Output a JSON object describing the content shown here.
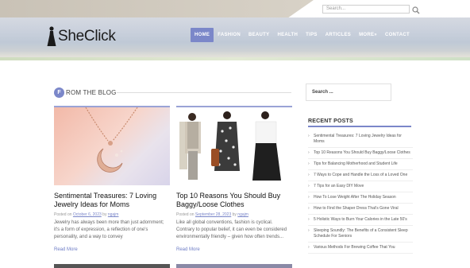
{
  "header": {
    "search_placeholder": "Search...",
    "logo_text": "SheClick",
    "nav": [
      {
        "label": "HOME",
        "active": true
      },
      {
        "label": "FASHION",
        "active": false
      },
      {
        "label": "BEAUTY",
        "active": false
      },
      {
        "label": "HEALTH",
        "active": false
      },
      {
        "label": "TIPS",
        "active": false
      },
      {
        "label": "ARTICLES",
        "active": false
      },
      {
        "label": "MORE»",
        "active": false
      },
      {
        "label": "CONTACT",
        "active": false
      }
    ]
  },
  "main": {
    "section_badge": "F",
    "section_title": "ROM THE BLOG",
    "posts": [
      {
        "title": "Sentimental Treasures: 7 Loving Jewelry Ideas for Moms",
        "meta_prefix": "Posted on",
        "date": "October 6, 2023",
        "meta_by": "by",
        "author": "ngajm",
        "excerpt": "Jewelry has always been more than just adornment; it's a form of expression, a reflection of one's personality, and a way to convey",
        "read_more": "Read More",
        "image": "necklace-photo"
      },
      {
        "title": "Top 10 Reasons You Should Buy Baggy/Loose Clothes",
        "meta_prefix": "Posted on",
        "date": "September 28, 2023",
        "meta_by": "by",
        "author": "ngajm",
        "excerpt": "Like all global conventions, fashion is cyclical. Contrary to popular belief, it can even be considered environmentally friendly – given how often trends...",
        "read_more": "Read More",
        "image": "clothes-photo"
      }
    ]
  },
  "sidebar": {
    "search_label": "Search ...",
    "recent_title": "RECENT POSTS",
    "recent_posts": [
      "Sentimental Treasures: 7 Loving Jewelry Ideas for Moms",
      "Top 10 Reasons You Should Buy Baggy/Loose Clothes",
      "Tips for Balancing Motherhood and Student Life",
      "7 Ways to Cope and Handle the Loss of a Loved One",
      "7 Tips for an Easy DIY Move",
      "How To Lose Weight After The Holiday Season",
      "How to Find the Shaper Dress That's Gone Viral",
      "5 Holistic Ways to Burn Your Calories in the Late 50's",
      "Sleeping Soundly: The Benefits of a Consistent Sleep Schedule For Seniors",
      "Various Methods For Brewing Coffee That You"
    ]
  },
  "colors": {
    "accent": "#7b87c9",
    "nav_text": "#ffffff",
    "link": "#6e7dc6"
  }
}
